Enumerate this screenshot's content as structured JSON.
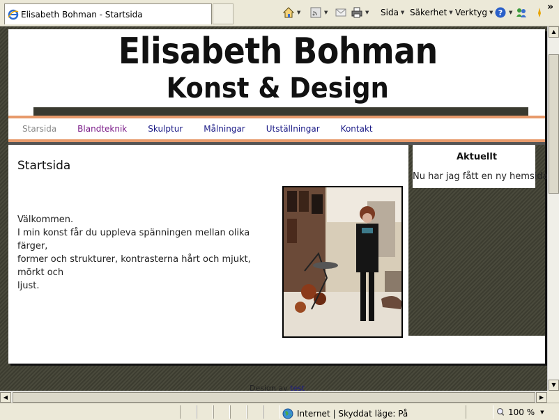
{
  "browser": {
    "tab_title": "Elisabeth Bohman - Startsida",
    "commands": {
      "page": "Sida",
      "safety": "Säkerhet",
      "tools": "Verktyg"
    },
    "status": {
      "zone": "Internet | Skyddat läge: På",
      "zoom": "100 %"
    }
  },
  "site": {
    "title": "Elisabeth Bohman",
    "subtitle": "Konst & Design",
    "nav": [
      {
        "label": "Starsida",
        "state": "active"
      },
      {
        "label": "Blandteknik",
        "state": "visited"
      },
      {
        "label": "Skulptur",
        "state": "link"
      },
      {
        "label": "Målningar",
        "state": "link"
      },
      {
        "label": "Utställningar",
        "state": "link"
      },
      {
        "label": "Kontakt",
        "state": "link"
      }
    ],
    "content": {
      "heading": "Startsida",
      "lines": [
        "Välkommen.",
        "I min konst får du uppleva  spänningen mellan olika färger,",
        "former och strukturer, kontrasterna hårt och mjukt, mörkt och",
        "ljust."
      ]
    },
    "sidebar": {
      "title": "Aktuellt",
      "text": "Nu har jag fått en ny hemsida."
    },
    "footer": {
      "text": "Design av",
      "link": "test"
    }
  },
  "colors": {
    "accent": "#e79a6b",
    "dark_pattern": "#3c3c30",
    "link": "#1a1a86",
    "visited": "#7a1a88"
  },
  "icons": [
    "ie-icon",
    "home-icon",
    "rss-icon",
    "mail-icon",
    "print-icon",
    "help-icon",
    "messenger-icon",
    "research-icon",
    "globe-icon",
    "zoom-icon"
  ]
}
